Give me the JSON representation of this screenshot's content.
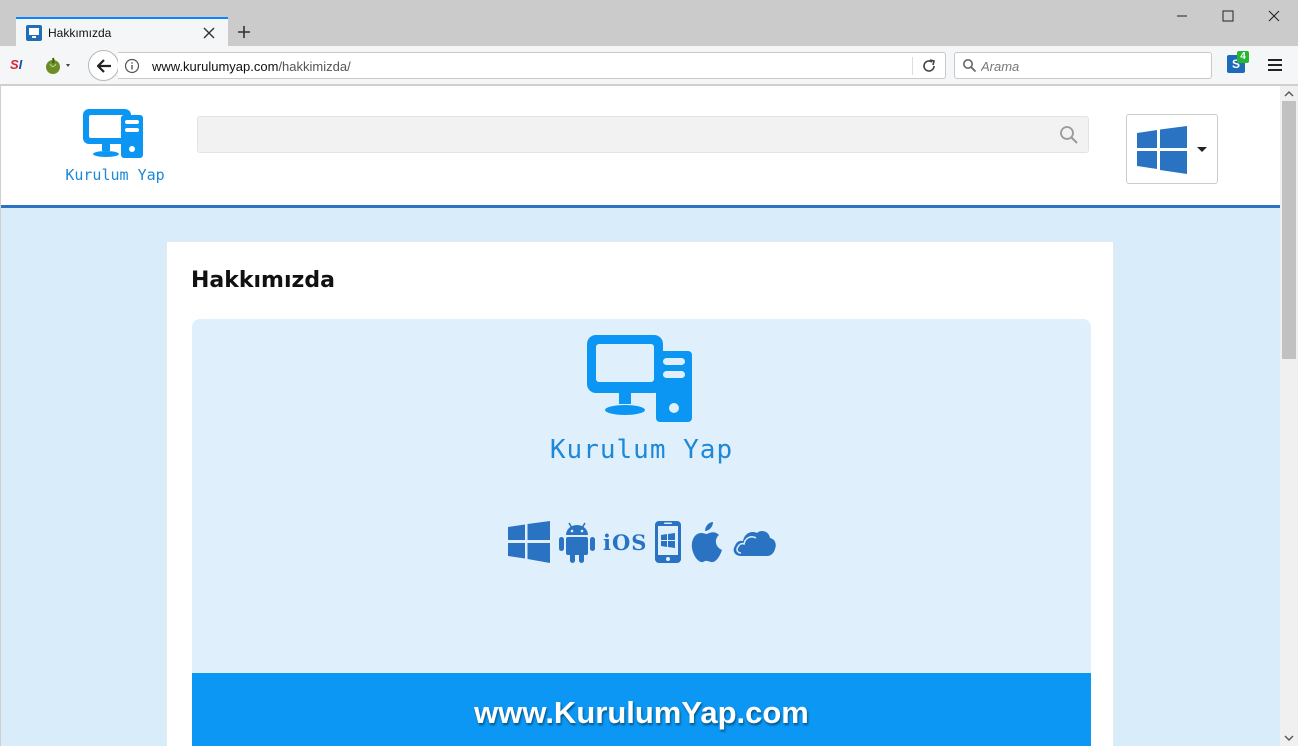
{
  "browser": {
    "tab_title": "Hakkımızda",
    "url_host": "www.kurulumyap.com",
    "url_path": "/hakkimizda/",
    "search_placeholder": "Arama",
    "extension_si": {
      "left": "S",
      "right": "I"
    },
    "extension_s_label": "S",
    "extension_badge": "4"
  },
  "site": {
    "logo_text": "Kurulum Yap",
    "search_value": "",
    "os_dropdown_icon": "windows-icon",
    "accent_color": "#2b72c2"
  },
  "content": {
    "page_title": "Hakkımızda",
    "banner": {
      "logo_text": "Kurulum Yap",
      "platform_icons": [
        "windows-icon",
        "android-icon",
        "ios-icon",
        "windows-phone-icon",
        "apple-icon",
        "cloud-icon"
      ],
      "ios_label": "iOS",
      "footer_url": "www.KurulumYap.com",
      "footer_color": "#0b97f3"
    }
  }
}
